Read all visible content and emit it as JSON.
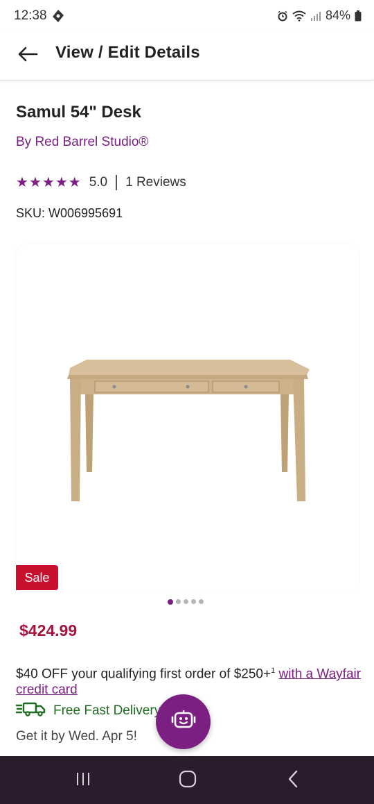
{
  "status_bar": {
    "time": "12:38",
    "battery": "84%"
  },
  "header": {
    "title": "View / Edit Details"
  },
  "product": {
    "title": "Samul 54\" Desk",
    "brand": "By Red Barrel Studio®",
    "rating_value": "5.0",
    "rating_stars": 5,
    "review_count": "1 Reviews",
    "sku": "SKU: W006995691",
    "sale_badge": "Sale",
    "price": "$424.99",
    "image_count": 5,
    "active_image": 1
  },
  "promo": {
    "text": "$40 OFF your qualifying first order of $250+",
    "footnote": "1",
    "link_text": "with a Wayfair credit card"
  },
  "shipping": {
    "label": "Free Fast Delivery",
    "delivery_date": "Get it by Wed. Apr 5!"
  },
  "colors": {
    "brand_purple": "#7b1f83",
    "sale_red": "#c8102e",
    "price_red": "#a3173e",
    "shipping_green": "#1e6b22",
    "nav_bar": "#2a1b2d"
  },
  "icons": {
    "status_left": "shield-icon",
    "back": "arrow-left-icon",
    "shipping": "truck-icon",
    "fab": "robot-assistant-icon",
    "nav": [
      "recent-apps-icon",
      "home-icon",
      "back-chevron-icon"
    ]
  }
}
